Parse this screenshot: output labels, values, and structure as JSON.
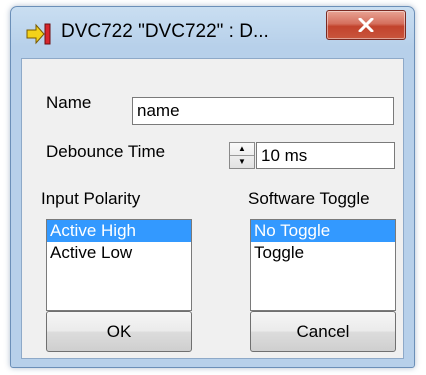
{
  "window": {
    "title": "DVC722 \"DVC722\" : D...",
    "close_label": "X"
  },
  "form": {
    "name_label": "Name",
    "name_value": "name",
    "debounce_label": "Debounce Time",
    "debounce_value": "10 ms",
    "input_polarity_label": "Input Polarity",
    "input_polarity_items": [
      "Active High",
      "Active Low"
    ],
    "input_polarity_selected": "Active High",
    "software_toggle_label": "Software Toggle",
    "software_toggle_items": [
      "No Toggle",
      "Toggle"
    ],
    "software_toggle_selected": "No Toggle"
  },
  "buttons": {
    "ok_label": "OK",
    "cancel_label": "Cancel"
  },
  "icons": {
    "app": "yellow-arrow-red-gate-icon",
    "close": "close-icon",
    "spin_up": "spin-up-icon",
    "spin_down": "spin-down-icon"
  },
  "colors": {
    "selection": "#3399ff",
    "close_button": "#c9553c",
    "title_bar": "#b7d0ea"
  }
}
